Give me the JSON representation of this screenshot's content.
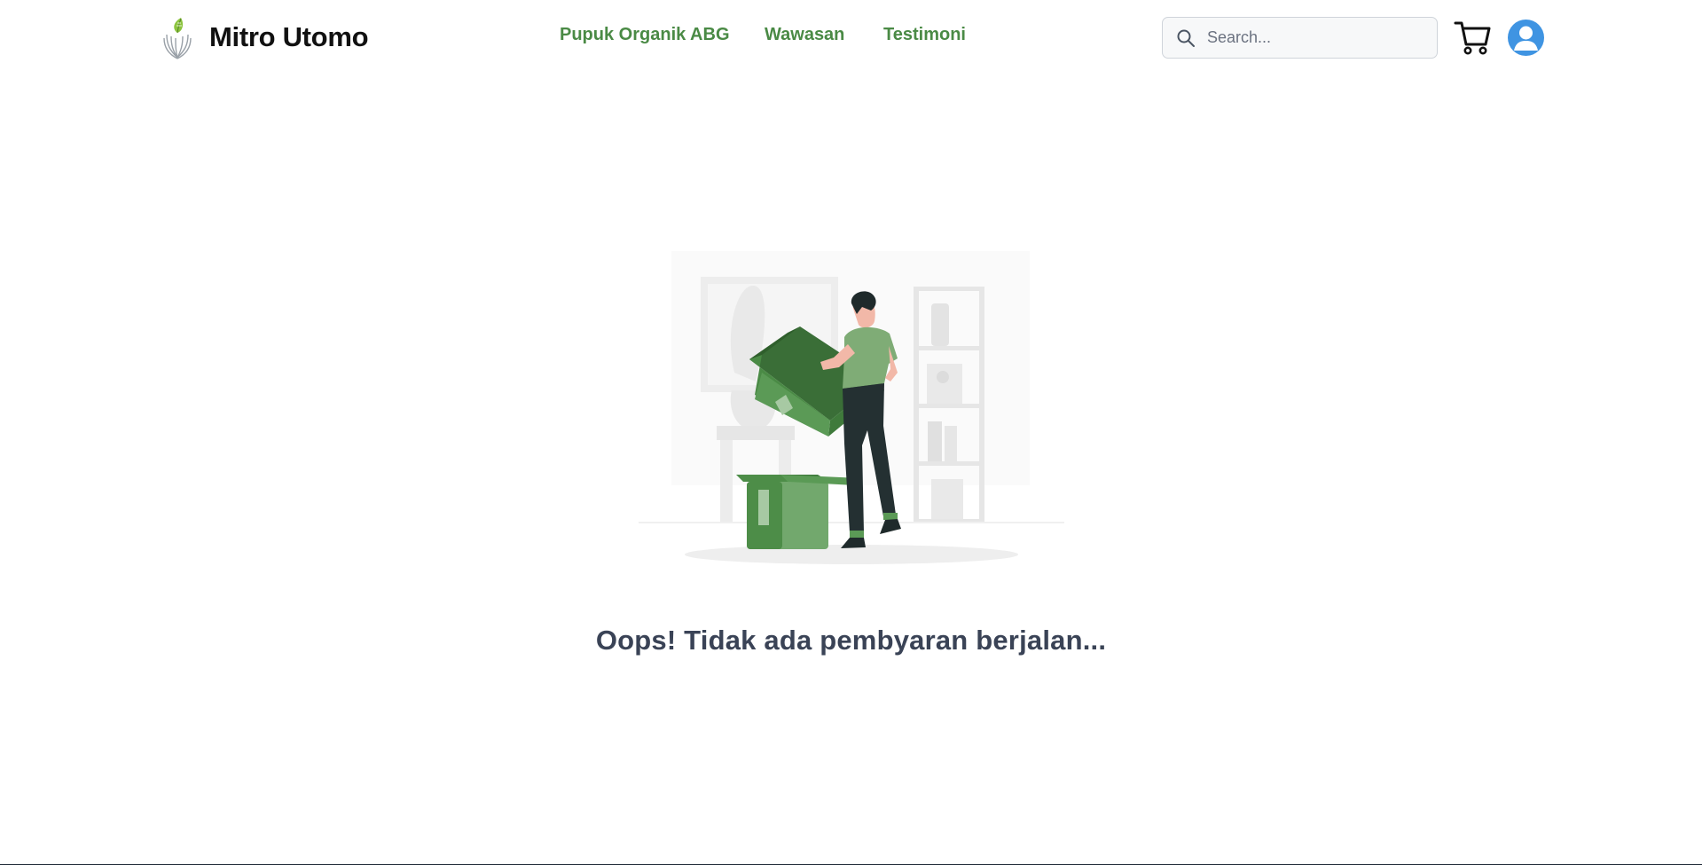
{
  "brand": {
    "name": "Mitro Utomo",
    "logo_icon": "leaf-wheat-logo-icon"
  },
  "nav": {
    "items": [
      {
        "label": "Pupuk Organik ABG"
      },
      {
        "label": "Wawasan"
      },
      {
        "label": "Testimoni"
      }
    ],
    "color": "#4a8a45"
  },
  "search": {
    "placeholder": "Search...",
    "value": "",
    "icon": "search-icon"
  },
  "header_actions": {
    "cart_icon": "cart-icon",
    "avatar_icon": "user-avatar-icon",
    "avatar_color": "#3f94e2"
  },
  "main": {
    "illustration": "empty-box-illustration",
    "message": "Oops! Tidak ada pembyaran berjalan..."
  },
  "colors": {
    "accent_green": "#4a8a45",
    "box_green": "#5b9a56",
    "text_dark": "#3a4356"
  }
}
